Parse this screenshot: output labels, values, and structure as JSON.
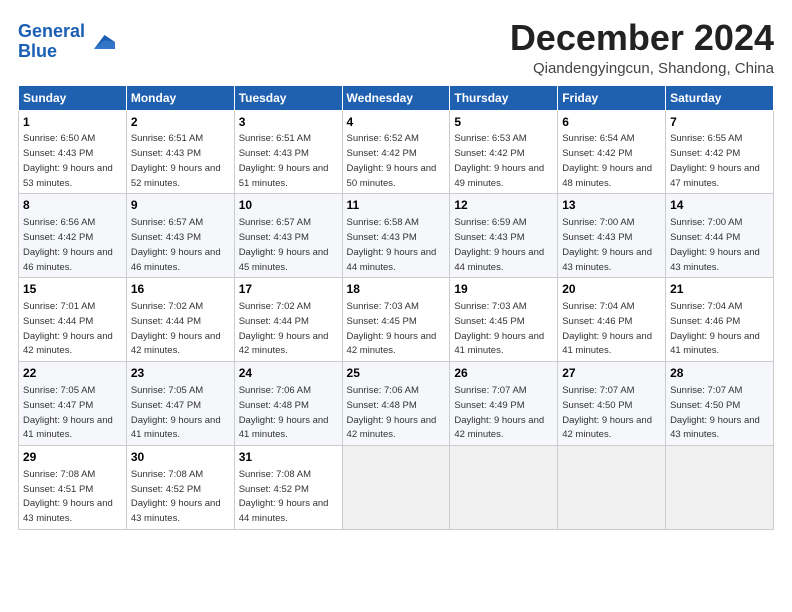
{
  "logo": {
    "line1": "General",
    "line2": "Blue"
  },
  "title": "December 2024",
  "subtitle": "Qiandengyingcun, Shandong, China",
  "days_of_week": [
    "Sunday",
    "Monday",
    "Tuesday",
    "Wednesday",
    "Thursday",
    "Friday",
    "Saturday"
  ],
  "weeks": [
    [
      {
        "day": "1",
        "sunrise": "Sunrise: 6:50 AM",
        "sunset": "Sunset: 4:43 PM",
        "daylight": "Daylight: 9 hours and 53 minutes."
      },
      {
        "day": "2",
        "sunrise": "Sunrise: 6:51 AM",
        "sunset": "Sunset: 4:43 PM",
        "daylight": "Daylight: 9 hours and 52 minutes."
      },
      {
        "day": "3",
        "sunrise": "Sunrise: 6:51 AM",
        "sunset": "Sunset: 4:43 PM",
        "daylight": "Daylight: 9 hours and 51 minutes."
      },
      {
        "day": "4",
        "sunrise": "Sunrise: 6:52 AM",
        "sunset": "Sunset: 4:42 PM",
        "daylight": "Daylight: 9 hours and 50 minutes."
      },
      {
        "day": "5",
        "sunrise": "Sunrise: 6:53 AM",
        "sunset": "Sunset: 4:42 PM",
        "daylight": "Daylight: 9 hours and 49 minutes."
      },
      {
        "day": "6",
        "sunrise": "Sunrise: 6:54 AM",
        "sunset": "Sunset: 4:42 PM",
        "daylight": "Daylight: 9 hours and 48 minutes."
      },
      {
        "day": "7",
        "sunrise": "Sunrise: 6:55 AM",
        "sunset": "Sunset: 4:42 PM",
        "daylight": "Daylight: 9 hours and 47 minutes."
      }
    ],
    [
      {
        "day": "8",
        "sunrise": "Sunrise: 6:56 AM",
        "sunset": "Sunset: 4:42 PM",
        "daylight": "Daylight: 9 hours and 46 minutes."
      },
      {
        "day": "9",
        "sunrise": "Sunrise: 6:57 AM",
        "sunset": "Sunset: 4:43 PM",
        "daylight": "Daylight: 9 hours and 46 minutes."
      },
      {
        "day": "10",
        "sunrise": "Sunrise: 6:57 AM",
        "sunset": "Sunset: 4:43 PM",
        "daylight": "Daylight: 9 hours and 45 minutes."
      },
      {
        "day": "11",
        "sunrise": "Sunrise: 6:58 AM",
        "sunset": "Sunset: 4:43 PM",
        "daylight": "Daylight: 9 hours and 44 minutes."
      },
      {
        "day": "12",
        "sunrise": "Sunrise: 6:59 AM",
        "sunset": "Sunset: 4:43 PM",
        "daylight": "Daylight: 9 hours and 44 minutes."
      },
      {
        "day": "13",
        "sunrise": "Sunrise: 7:00 AM",
        "sunset": "Sunset: 4:43 PM",
        "daylight": "Daylight: 9 hours and 43 minutes."
      },
      {
        "day": "14",
        "sunrise": "Sunrise: 7:00 AM",
        "sunset": "Sunset: 4:44 PM",
        "daylight": "Daylight: 9 hours and 43 minutes."
      }
    ],
    [
      {
        "day": "15",
        "sunrise": "Sunrise: 7:01 AM",
        "sunset": "Sunset: 4:44 PM",
        "daylight": "Daylight: 9 hours and 42 minutes."
      },
      {
        "day": "16",
        "sunrise": "Sunrise: 7:02 AM",
        "sunset": "Sunset: 4:44 PM",
        "daylight": "Daylight: 9 hours and 42 minutes."
      },
      {
        "day": "17",
        "sunrise": "Sunrise: 7:02 AM",
        "sunset": "Sunset: 4:44 PM",
        "daylight": "Daylight: 9 hours and 42 minutes."
      },
      {
        "day": "18",
        "sunrise": "Sunrise: 7:03 AM",
        "sunset": "Sunset: 4:45 PM",
        "daylight": "Daylight: 9 hours and 42 minutes."
      },
      {
        "day": "19",
        "sunrise": "Sunrise: 7:03 AM",
        "sunset": "Sunset: 4:45 PM",
        "daylight": "Daylight: 9 hours and 41 minutes."
      },
      {
        "day": "20",
        "sunrise": "Sunrise: 7:04 AM",
        "sunset": "Sunset: 4:46 PM",
        "daylight": "Daylight: 9 hours and 41 minutes."
      },
      {
        "day": "21",
        "sunrise": "Sunrise: 7:04 AM",
        "sunset": "Sunset: 4:46 PM",
        "daylight": "Daylight: 9 hours and 41 minutes."
      }
    ],
    [
      {
        "day": "22",
        "sunrise": "Sunrise: 7:05 AM",
        "sunset": "Sunset: 4:47 PM",
        "daylight": "Daylight: 9 hours and 41 minutes."
      },
      {
        "day": "23",
        "sunrise": "Sunrise: 7:05 AM",
        "sunset": "Sunset: 4:47 PM",
        "daylight": "Daylight: 9 hours and 41 minutes."
      },
      {
        "day": "24",
        "sunrise": "Sunrise: 7:06 AM",
        "sunset": "Sunset: 4:48 PM",
        "daylight": "Daylight: 9 hours and 41 minutes."
      },
      {
        "day": "25",
        "sunrise": "Sunrise: 7:06 AM",
        "sunset": "Sunset: 4:48 PM",
        "daylight": "Daylight: 9 hours and 42 minutes."
      },
      {
        "day": "26",
        "sunrise": "Sunrise: 7:07 AM",
        "sunset": "Sunset: 4:49 PM",
        "daylight": "Daylight: 9 hours and 42 minutes."
      },
      {
        "day": "27",
        "sunrise": "Sunrise: 7:07 AM",
        "sunset": "Sunset: 4:50 PM",
        "daylight": "Daylight: 9 hours and 42 minutes."
      },
      {
        "day": "28",
        "sunrise": "Sunrise: 7:07 AM",
        "sunset": "Sunset: 4:50 PM",
        "daylight": "Daylight: 9 hours and 43 minutes."
      }
    ],
    [
      {
        "day": "29",
        "sunrise": "Sunrise: 7:08 AM",
        "sunset": "Sunset: 4:51 PM",
        "daylight": "Daylight: 9 hours and 43 minutes."
      },
      {
        "day": "30",
        "sunrise": "Sunrise: 7:08 AM",
        "sunset": "Sunset: 4:52 PM",
        "daylight": "Daylight: 9 hours and 43 minutes."
      },
      {
        "day": "31",
        "sunrise": "Sunrise: 7:08 AM",
        "sunset": "Sunset: 4:52 PM",
        "daylight": "Daylight: 9 hours and 44 minutes."
      },
      null,
      null,
      null,
      null
    ]
  ]
}
